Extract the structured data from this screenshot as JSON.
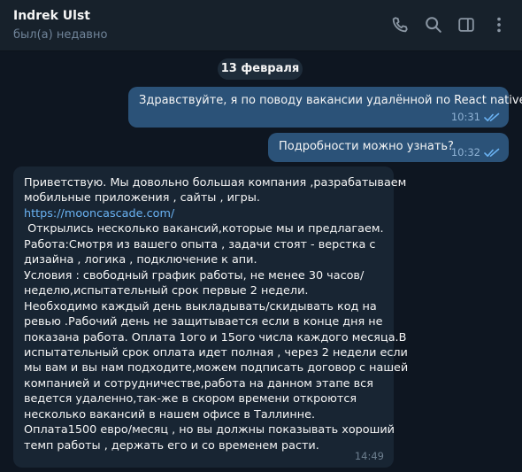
{
  "header": {
    "name": "Indrek Ulst",
    "status": "был(а) недавно",
    "icons": [
      "phone-icon",
      "search-icon",
      "sidebar-icon",
      "more-icon"
    ]
  },
  "date_separator": "13 февраля",
  "outgoing": [
    {
      "text": "Здравствуйте, я по поводу вакансии удалённой по React native",
      "time": "10:31",
      "status": "read"
    },
    {
      "text": "Подробности можно узнать?",
      "time": "10:32",
      "status": "read"
    }
  ],
  "incoming": {
    "lines": [
      "Приветствую. Мы довольно большая компания ,разрабатываем",
      "мобильные приложения , сайты , игры.",
      "https://mooncascade.com/",
      " Открылись несколько вакансий,которые мы и предлагаем.",
      "Работа:Смотря из вашего опыта , задачи стоят - верстка с",
      "дизайна , логика , подключение к апи.",
      "Условия : свободный график работы, не менее 30 часов/",
      "неделю,испытательный срок первые 2 недели.",
      "Необходимо каждый день выкладывать/скидывать код на",
      "ревью .Рабочий день не защитывается если в конце дня не",
      "показана работа. Оплата 1ого и 15ого числа каждого месяца.В",
      "испытательный срок оплата идет полная , через 2 недели если",
      "мы вам и вы нам подходите,можем подписать договор с нашей",
      "компанией и сотрудничестве,работа на данном этапе вся",
      "ведется удаленно,так-же в скором времени откроются",
      "несколько вакансий в нашем офисе в Таллинне.",
      "Оплата1500 евро/месяц , но вы должны показывать хороший",
      "темп работы , держать его и со временем расти."
    ],
    "time": "14:49"
  },
  "colors": {
    "background": "#0e1621",
    "header": "#17212b",
    "outgoing_bubble": "#2b5278",
    "incoming_bubble": "#182533",
    "link": "#6ab2f2",
    "read_check": "#6ab2f2"
  }
}
